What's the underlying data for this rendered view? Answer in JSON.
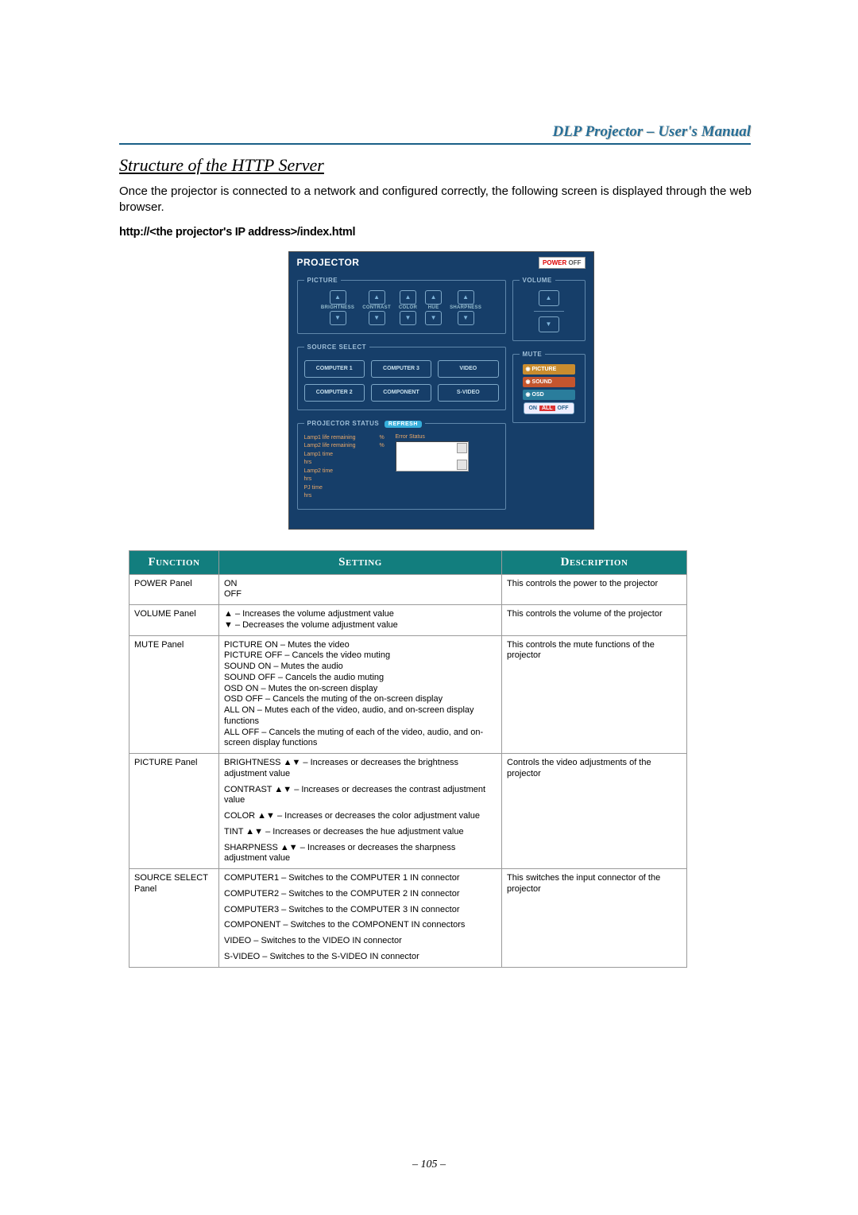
{
  "header": {
    "title": "DLP Projector – User's Manual"
  },
  "section": {
    "title": "Structure of the HTTP Server",
    "intro": "Once the projector is connected to a network and configured correctly, the following screen is displayed through the web browser.",
    "url_line": "http://<the projector's IP address>/index.html"
  },
  "projector_panel": {
    "title": "PROJECTOR",
    "power": {
      "label_power": "POWER",
      "label_off": "OFF"
    },
    "picture": {
      "legend": "PICTURE",
      "controls": [
        "BRIGHTNESS",
        "CONTRAST",
        "COLOR",
        "HUE",
        "SHARPNESS"
      ]
    },
    "source_select": {
      "legend": "SOURCE SELECT",
      "buttons": [
        "COMPUTER 1",
        "COMPUTER 3",
        "VIDEO",
        "COMPUTER 2",
        "COMPONENT",
        "S-VIDEO"
      ]
    },
    "status": {
      "legend": "PROJECTOR STATUS",
      "refresh": "REFRESH",
      "rows": [
        {
          "label": "Lamp1 life remaining",
          "unit": "%"
        },
        {
          "label": "Lamp2 life remaining",
          "unit": "%"
        },
        {
          "label": "Lamp1 time",
          "unit": "hrs"
        },
        {
          "label": "Lamp2 time",
          "unit": "hrs"
        },
        {
          "label": "PJ time",
          "unit": "hrs"
        }
      ],
      "error_label": "Error Status"
    },
    "volume": {
      "legend": "VOLUME"
    },
    "mute": {
      "legend": "MUTE",
      "items": [
        "PICTURE",
        "SOUND",
        "OSD"
      ],
      "all": {
        "on": "ON",
        "mid": "ALL",
        "off": "OFF"
      }
    }
  },
  "table": {
    "headers": {
      "function": "Function",
      "setting": "Setting",
      "description": "Description"
    },
    "rows": [
      {
        "function": "POWER Panel",
        "setting": [
          "ON",
          "OFF"
        ],
        "description": "This controls the power to the projector"
      },
      {
        "function": "VOLUME Panel",
        "setting": [
          "▲ – Increases the volume adjustment value",
          "▼ – Decreases the volume adjustment value"
        ],
        "description": "This controls the volume of the projector"
      },
      {
        "function": "MUTE Panel",
        "setting": [
          "PICTURE ON – Mutes the video",
          "PICTURE OFF – Cancels the video muting",
          "SOUND ON – Mutes the audio",
          "SOUND OFF – Cancels the audio muting",
          "OSD ON – Mutes the on-screen display",
          "OSD OFF – Cancels the muting of the on-screen display",
          "ALL ON – Mutes each of the video, audio, and on-screen display functions",
          "ALL OFF – Cancels the muting of each of the video, audio, and on-screen display functions"
        ],
        "description": "This controls the mute functions of the projector"
      },
      {
        "function": "PICTURE Panel",
        "setting_paras": [
          "BRIGHTNESS ▲▼ – Increases or decreases the brightness adjustment value",
          "CONTRAST ▲▼ – Increases or decreases the contrast adjustment value",
          "COLOR ▲▼ – Increases or decreases the color adjustment value",
          "TINT ▲▼ – Increases or decreases the hue adjustment value",
          "SHARPNESS ▲▼ – Increases or decreases the sharpness adjustment value"
        ],
        "description": "Controls the video adjustments of the projector"
      },
      {
        "function": "SOURCE SELECT Panel",
        "setting_paras": [
          "COMPUTER1 – Switches to the COMPUTER 1 IN connector",
          "COMPUTER2 – Switches to the COMPUTER 2 IN connector",
          "COMPUTER3 – Switches to the COMPUTER 3 IN connector",
          "COMPONENT – Switches to the COMPONENT IN connectors",
          "VIDEO – Switches to the VIDEO IN connector",
          "S-VIDEO – Switches to the S-VIDEO IN connector"
        ],
        "description": "This switches the input connector of the projector"
      }
    ]
  },
  "page_number": "– 105 –"
}
